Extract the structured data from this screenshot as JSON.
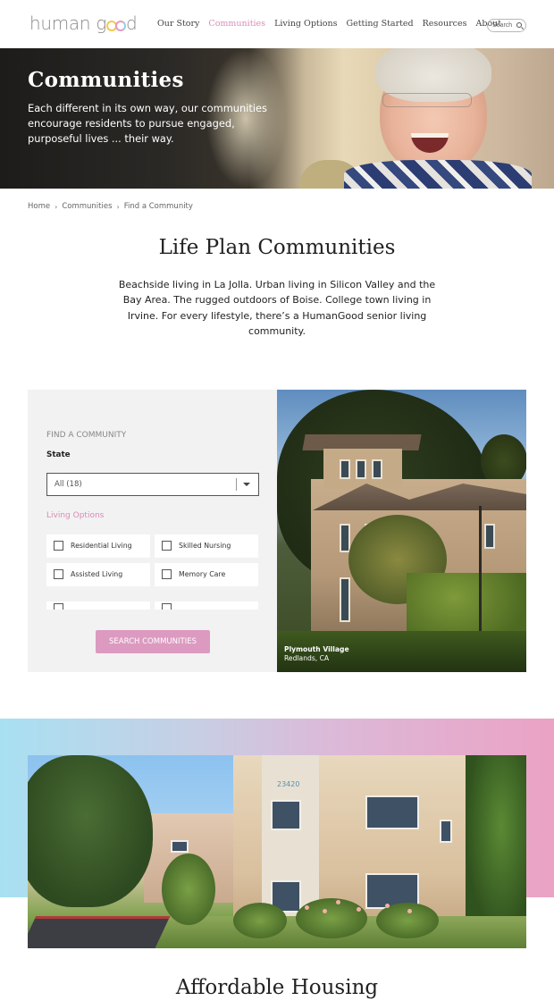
{
  "header": {
    "logo_text_start": "human g",
    "logo_text_end": "d",
    "nav": [
      {
        "label": "Our Story",
        "active": false
      },
      {
        "label": "Communities",
        "active": true
      },
      {
        "label": "Living Options",
        "active": false
      },
      {
        "label": "Getting Started",
        "active": false
      },
      {
        "label": "Resources",
        "active": false
      },
      {
        "label": "About",
        "active": false
      }
    ],
    "search_placeholder": "Search",
    "search_icon": "magnifier-icon"
  },
  "hero": {
    "title": "Communities",
    "text": "Each different in its own way, our communities encourage residents to pursue engaged, purposeful lives ... their way."
  },
  "breadcrumb": {
    "items": [
      "Home",
      "Communities",
      "Find a Community"
    ],
    "separator": "›"
  },
  "intro": {
    "title": "Life Plan Communities",
    "text": "Beachside living in La Jolla. Urban living in Silicon Valley and the Bay Area. The rugged outdoors of Boise. College town living in Irvine. For every lifestyle, there’s a HumanGood senior living community."
  },
  "finder": {
    "heading": "FIND A COMMUNITY",
    "state_label": "State",
    "state_value": "All (18)",
    "options_label": "Living Options",
    "options": [
      {
        "label": "Residential Living",
        "checked": false
      },
      {
        "label": "Skilled Nursing",
        "checked": false
      },
      {
        "label": "Assisted Living",
        "checked": false
      },
      {
        "label": "Memory Care",
        "checked": false
      },
      {
        "label": "",
        "checked": false
      },
      {
        "label": "",
        "checked": false
      }
    ],
    "button_label": "SEARCH COMMUNITIES"
  },
  "photo": {
    "caption_name": "Plymouth Village",
    "caption_location": "Redlands, CA"
  },
  "feature": {
    "building_number": "23420"
  },
  "section2": {
    "title": "Affordable Housing"
  },
  "colors": {
    "accent_pink": "#d98ab7",
    "button_pink": "#dc9ac0",
    "gradient_start": "#a8e0f2",
    "gradient_end": "#eba2c4"
  }
}
